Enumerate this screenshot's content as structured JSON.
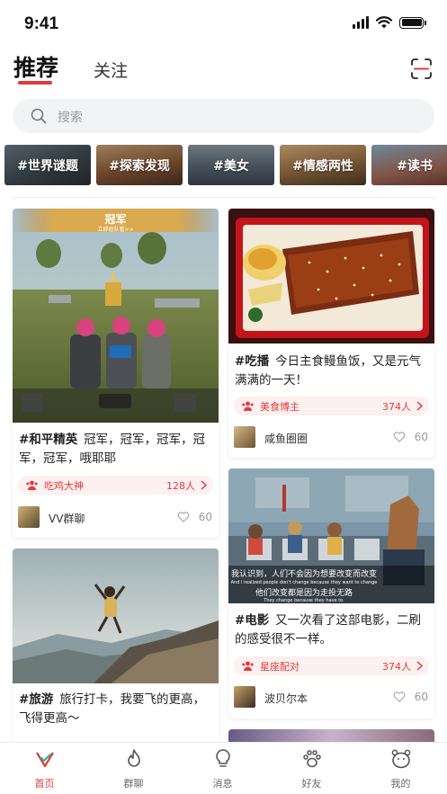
{
  "status_bar": {
    "time": "9:41"
  },
  "header": {
    "tabs": [
      {
        "label": "推荐",
        "active": true
      },
      {
        "label": "关注",
        "active": false
      }
    ],
    "scan_icon": "scan-icon"
  },
  "search": {
    "placeholder": "搜索"
  },
  "topics": [
    {
      "label": "#世界谜题"
    },
    {
      "label": "#探索发现"
    },
    {
      "label": "#美女"
    },
    {
      "label": "#情感两性"
    },
    {
      "label": "#读书"
    }
  ],
  "feed": {
    "left": [
      {
        "image_overlay": {
          "title": "冠军",
          "subtitle": "立即组队看>>"
        },
        "tag": "#和平精英",
        "text": "冠军，冠军，冠军，冠军，冠军，哦耶耶",
        "group": {
          "name": "吃鸡大神",
          "count": "128人"
        },
        "author": "VV群聊",
        "likes": "60"
      },
      {
        "tag": "#旅游",
        "text": "旅行打卡，我要飞的更高，飞得更高～"
      }
    ],
    "right": [
      {
        "tag": "#吃播",
        "text": "今日主食鳗鱼饭，又是元气满满的一天！",
        "group": {
          "name": "美食博主",
          "count": "374人"
        },
        "author": "咸鱼圈圈",
        "likes": "60"
      },
      {
        "subtitles": [
          "我认识到，人们不会因为想要改变而改变",
          "And I realized people don't change because they want to change",
          "他们改变都是因为走投无路",
          "They change because they have to."
        ],
        "tag": "#电影",
        "text": "又一次看了这部电影，二刷的感受很不一样。",
        "group": {
          "name": "星座配对",
          "count": "374人"
        },
        "author": "波贝尔本",
        "likes": "60"
      }
    ]
  },
  "tab_bar": [
    {
      "label": "首页",
      "icon": "home-icon",
      "active": true
    },
    {
      "label": "群聊",
      "icon": "flame-icon",
      "active": false
    },
    {
      "label": "消息",
      "icon": "bulb-icon",
      "active": false
    },
    {
      "label": "好友",
      "icon": "paw-icon",
      "active": false
    },
    {
      "label": "我的",
      "icon": "bear-face-icon",
      "active": false
    }
  ],
  "colors": {
    "accent": "#e23b3b",
    "pill_bg": "#fdf0f0",
    "search_bg": "#f2f3f5"
  }
}
